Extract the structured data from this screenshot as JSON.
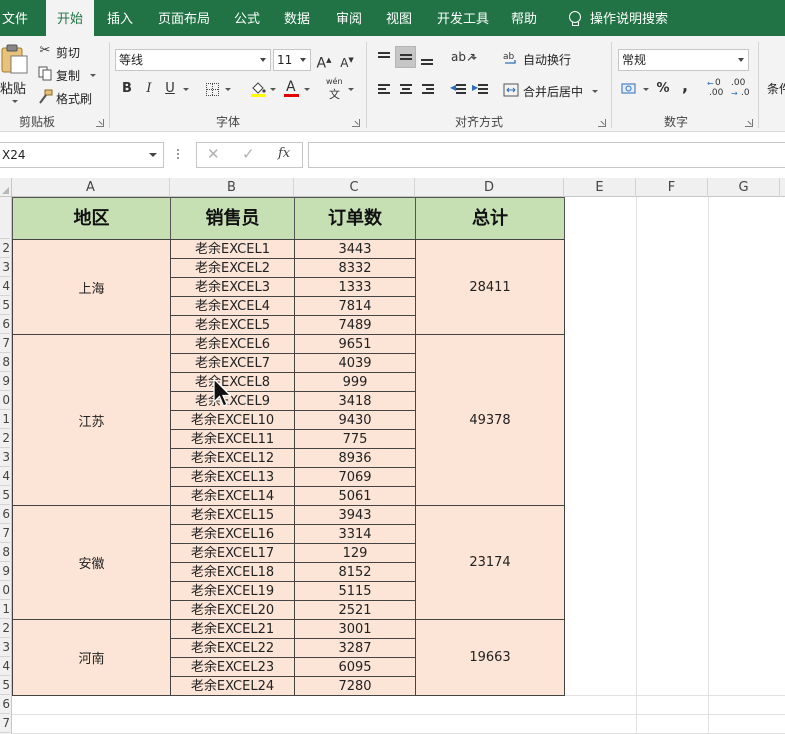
{
  "tabs": [
    {
      "label": "文件",
      "active": false
    },
    {
      "label": "开始",
      "active": true
    },
    {
      "label": "插入",
      "active": false
    },
    {
      "label": "页面布局",
      "active": false
    },
    {
      "label": "公式",
      "active": false
    },
    {
      "label": "数据",
      "active": false
    },
    {
      "label": "审阅",
      "active": false
    },
    {
      "label": "视图",
      "active": false
    },
    {
      "label": "开发工具",
      "active": false
    },
    {
      "label": "帮助",
      "active": false
    }
  ],
  "tell_me": "操作说明搜索",
  "ribbon": {
    "clipboard": {
      "label": "剪贴板",
      "paste": "粘贴",
      "cut": "剪切",
      "copy": "复制",
      "format_painter": "格式刷"
    },
    "font": {
      "label": "字体",
      "font_name": "等线",
      "font_size": "11",
      "bold": "B",
      "italic": "I",
      "underline": "U",
      "grow": "A",
      "shrink": "A",
      "font_color": "A",
      "phonetic": "wén"
    },
    "alignment": {
      "label": "对齐方式",
      "wrap_text": "自动换行",
      "merge_center": "合并后居中"
    },
    "number": {
      "label": "数字",
      "format": "常规",
      "percent": "%",
      "comma": ",",
      "inc_decimal": ".00",
      "dec_decimal": ".00"
    },
    "styles": {
      "conditional_partial": "条件"
    }
  },
  "formula_bar": {
    "name_box": "X24",
    "fx": "fx",
    "value": ""
  },
  "columns": [
    "A",
    "B",
    "C",
    "D",
    "E",
    "F",
    "G"
  ],
  "row_numbers_visible": [
    "",
    "2",
    "3",
    "4",
    "5",
    "6",
    "7",
    "8",
    "9",
    "0",
    "1",
    "2",
    "3",
    "4",
    "5",
    "6",
    "7",
    "8",
    "9",
    "0",
    "1",
    "2",
    "3",
    "4",
    "5",
    "6",
    "7"
  ],
  "table": {
    "headers": [
      "地区",
      "销售员",
      "订单数",
      "总计"
    ],
    "groups": [
      {
        "region": "上海",
        "total": "28411",
        "rows": [
          {
            "seller": "老余EXCEL1",
            "orders": "3443"
          },
          {
            "seller": "老余EXCEL2",
            "orders": "8332"
          },
          {
            "seller": "老余EXCEL3",
            "orders": "1333"
          },
          {
            "seller": "老余EXCEL4",
            "orders": "7814"
          },
          {
            "seller": "老余EXCEL5",
            "orders": "7489"
          }
        ]
      },
      {
        "region": "江苏",
        "total": "49378",
        "rows": [
          {
            "seller": "老余EXCEL6",
            "orders": "9651"
          },
          {
            "seller": "老余EXCEL7",
            "orders": "4039"
          },
          {
            "seller": "老余EXCEL8",
            "orders": "999"
          },
          {
            "seller": "老余EXCEL9",
            "orders": "3418"
          },
          {
            "seller": "老余EXCEL10",
            "orders": "9430"
          },
          {
            "seller": "老余EXCEL11",
            "orders": "775"
          },
          {
            "seller": "老余EXCEL12",
            "orders": "8936"
          },
          {
            "seller": "老余EXCEL13",
            "orders": "7069"
          },
          {
            "seller": "老余EXCEL14",
            "orders": "5061"
          }
        ]
      },
      {
        "region": "安徽",
        "total": "23174",
        "rows": [
          {
            "seller": "老余EXCEL15",
            "orders": "3943"
          },
          {
            "seller": "老余EXCEL16",
            "orders": "3314"
          },
          {
            "seller": "老余EXCEL17",
            "orders": "129"
          },
          {
            "seller": "老余EXCEL18",
            "orders": "8152"
          },
          {
            "seller": "老余EXCEL19",
            "orders": "5115"
          },
          {
            "seller": "老余EXCEL20",
            "orders": "2521"
          }
        ]
      },
      {
        "region": "河南",
        "total": "19663",
        "rows": [
          {
            "seller": "老余EXCEL21",
            "orders": "3001"
          },
          {
            "seller": "老余EXCEL22",
            "orders": "3287"
          },
          {
            "seller": "老余EXCEL23",
            "orders": "6095"
          },
          {
            "seller": "老余EXCEL24",
            "orders": "7280"
          }
        ]
      }
    ]
  },
  "colors": {
    "excel_green": "#217346",
    "header_fill": "#c6e0b4",
    "body_fill": "#fce4d6",
    "font_color_bar": "#e00000"
  }
}
